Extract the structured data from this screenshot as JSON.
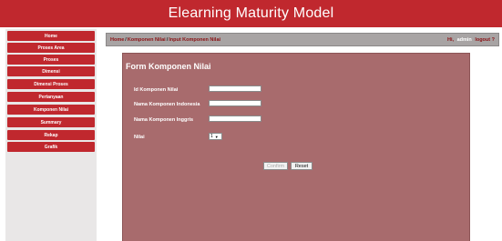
{
  "header": {
    "title": "Elearning Maturity Model"
  },
  "sidebar": {
    "items": [
      {
        "label": "Home"
      },
      {
        "label": "Proses Area"
      },
      {
        "label": "Proses"
      },
      {
        "label": "Dimensi"
      },
      {
        "label": "Dimensi Proses"
      },
      {
        "label": "Pertanyaan"
      },
      {
        "label": "Komponen Nilai"
      },
      {
        "label": "Summary"
      },
      {
        "label": "Rekap"
      },
      {
        "label": "Grafik"
      }
    ]
  },
  "breadcrumb": {
    "items": [
      "Home",
      "Komponen Nilai",
      "Input Komponen Nilai"
    ],
    "separator": "/",
    "greeting": "Hi,",
    "username": "admin",
    "logout": "logout ?"
  },
  "form": {
    "title": "Form Komponen Nilai",
    "fields": [
      {
        "label": "Id Komponen Nilai",
        "value": "",
        "placeholder": ""
      },
      {
        "label": "Nama Komponen Indonesia",
        "value": "",
        "placeholder": ""
      },
      {
        "label": "Nama Komponen Inggris",
        "value": "",
        "placeholder": ""
      }
    ],
    "nilai": {
      "label": "Nilai",
      "selected": "1"
    },
    "buttons": {
      "confirm": "Confirm",
      "reset": "Reset"
    }
  },
  "colors": {
    "brand_red": "#c0282e",
    "panel": "#a86b6d",
    "breadcrumb_bar": "#a8a4a4",
    "sidebar_bg": "#e9e7e7"
  }
}
